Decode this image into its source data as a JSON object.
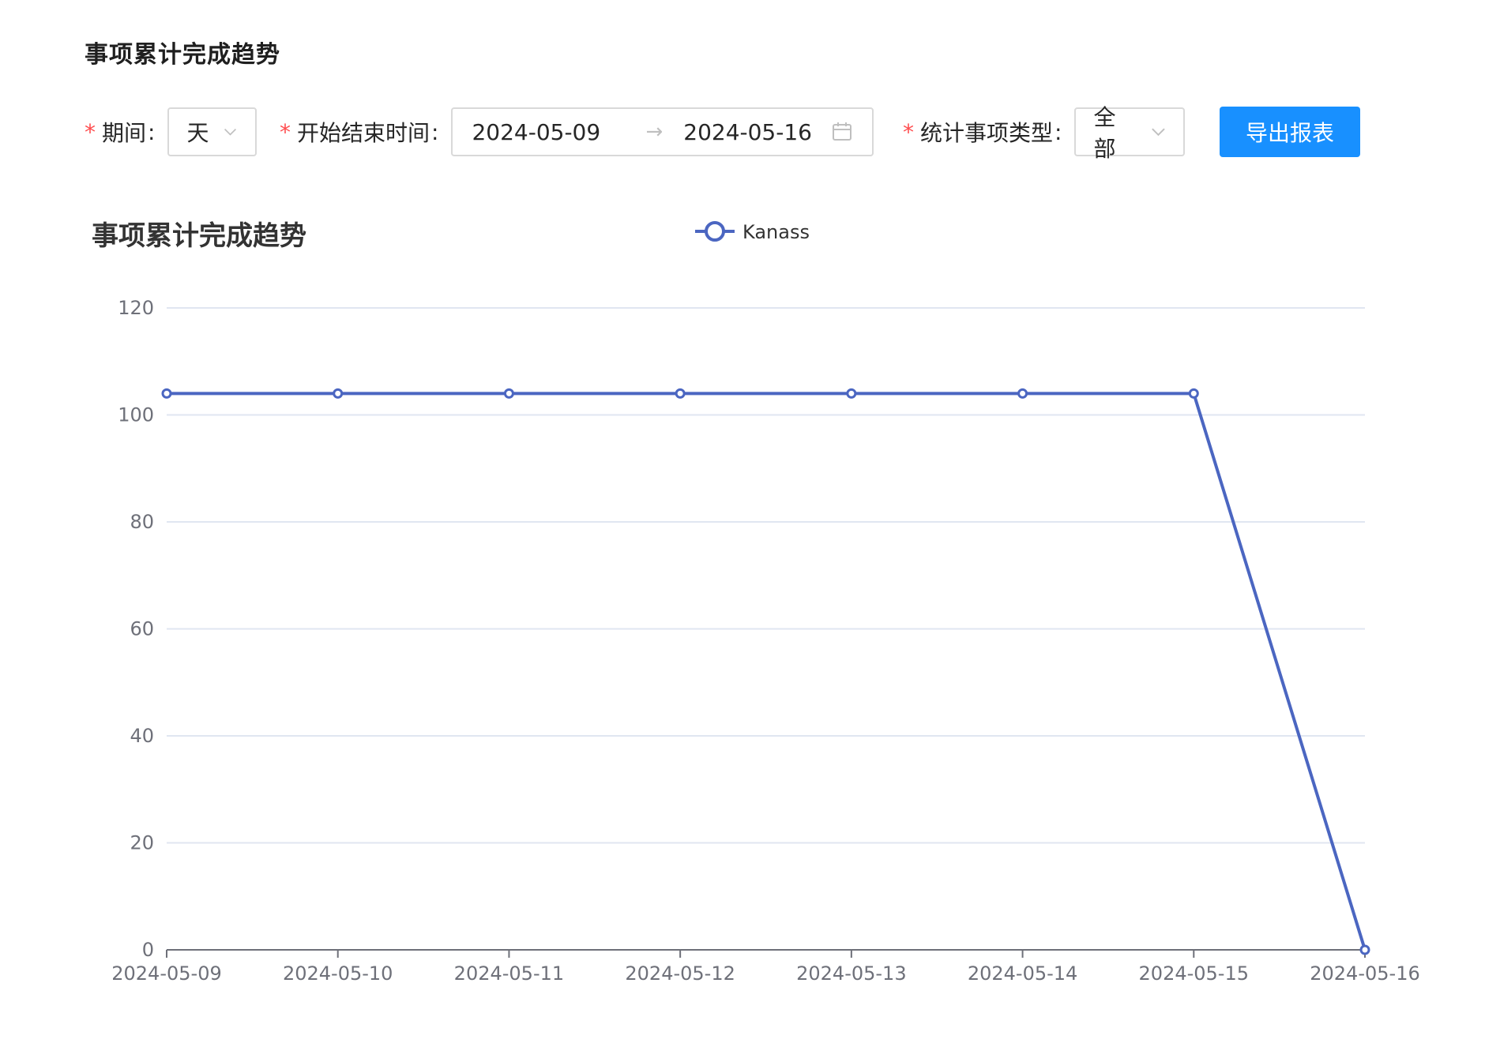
{
  "page": {
    "title": "事项累计完成趋势"
  },
  "filters": {
    "period": {
      "required_mark": "*",
      "label": "期间",
      "value": "天"
    },
    "date_range": {
      "required_mark": "*",
      "label": "开始结束时间",
      "start": "2024-05-09",
      "end": "2024-05-16",
      "separator": "→"
    },
    "item_type": {
      "required_mark": "*",
      "label": "统计事项类型",
      "value": "全部"
    },
    "colon": ":",
    "export_label": "导出报表"
  },
  "icons": {
    "dropdown": "chevron-down-icon",
    "calendar": "calendar-icon"
  },
  "colors": {
    "primary": "#1890ff",
    "required": "#ff4d4f",
    "series": "#4b66c1"
  },
  "chart_data": {
    "type": "line",
    "title": "事项累计完成趋势",
    "categories": [
      "2024-05-09",
      "2024-05-10",
      "2024-05-11",
      "2024-05-12",
      "2024-05-13",
      "2024-05-14",
      "2024-05-15",
      "2024-05-16"
    ],
    "series": [
      {
        "name": "Kanass",
        "values": [
          104,
          104,
          104,
          104,
          104,
          104,
          104,
          0
        ]
      }
    ],
    "ylim": [
      0,
      120
    ],
    "yticks": [
      0,
      20,
      40,
      60,
      80,
      100,
      120
    ],
    "xlabel": "",
    "ylabel": "",
    "grid": true,
    "legend": "top-center"
  }
}
